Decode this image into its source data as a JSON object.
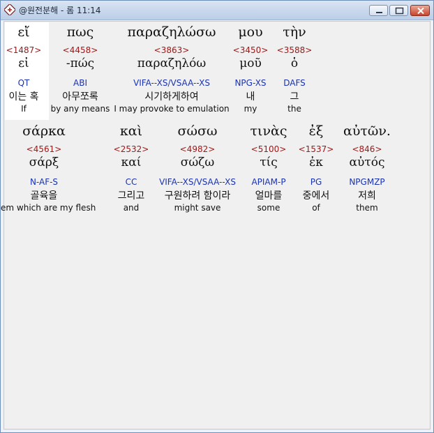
{
  "window": {
    "title": "@원전분해 - 롬 11:14",
    "icons": {
      "app": "bible-app-icon",
      "minimize": "minimize-icon",
      "maximize": "maximize-icon",
      "close": "close-icon"
    }
  },
  "rows": [
    {
      "words": [
        {
          "greek": "εἴ",
          "strong": "<1487>",
          "lemma": "εἰ",
          "parse": "QT",
          "korean": "이는 혹",
          "english": "If"
        },
        {
          "greek": "πως",
          "strong": "<4458>",
          "lemma": "-πώς",
          "parse": "ABI",
          "korean": "아무쪼록",
          "english": "by any means"
        },
        {
          "greek": "παραζηλώσω",
          "strong": "<3863>",
          "lemma": "παραζηλόω",
          "parse": "VIFA--XS/VSAA--XS",
          "korean": "시기하게하여",
          "english": "I may provoke to emulation"
        },
        {
          "greek": "μου",
          "strong": "<3450>",
          "lemma": "μοῦ",
          "parse": "NPG-XS",
          "korean": "내",
          "english": "my"
        },
        {
          "greek": "τὴν",
          "strong": "<3588>",
          "lemma": "ὁ",
          "parse": "DAFS",
          "korean": "그",
          "english": "the"
        }
      ]
    },
    {
      "words": [
        {
          "greek": "σάρκα",
          "strong": "<4561>",
          "lemma": "σάρξ",
          "parse": "N-AF-S",
          "korean": "골육을",
          "english": "them which are my flesh"
        },
        {
          "greek": "καὶ",
          "strong": "<2532>",
          "lemma": "καί",
          "parse": "CC",
          "korean": "그리고",
          "english": "and"
        },
        {
          "greek": "σώσω",
          "strong": "<4982>",
          "lemma": "σώζω",
          "parse": "VIFA--XS/VSAA--XS",
          "korean": "구원하려 함이라",
          "english": "might save"
        },
        {
          "greek": "τινὰς",
          "strong": "<5100>",
          "lemma": "τίς",
          "parse": "APIAM-P",
          "korean": "얼마를",
          "english": "some"
        },
        {
          "greek": "ἐξ",
          "strong": "<1537>",
          "lemma": "ἐκ",
          "parse": "PG",
          "korean": "중에서",
          "english": "of"
        },
        {
          "greek": "αὐτῶν.",
          "strong": "<846>",
          "lemma": "αὐτός",
          "parse": "NPGMZP",
          "korean": "저희",
          "english": "them"
        }
      ]
    }
  ]
}
